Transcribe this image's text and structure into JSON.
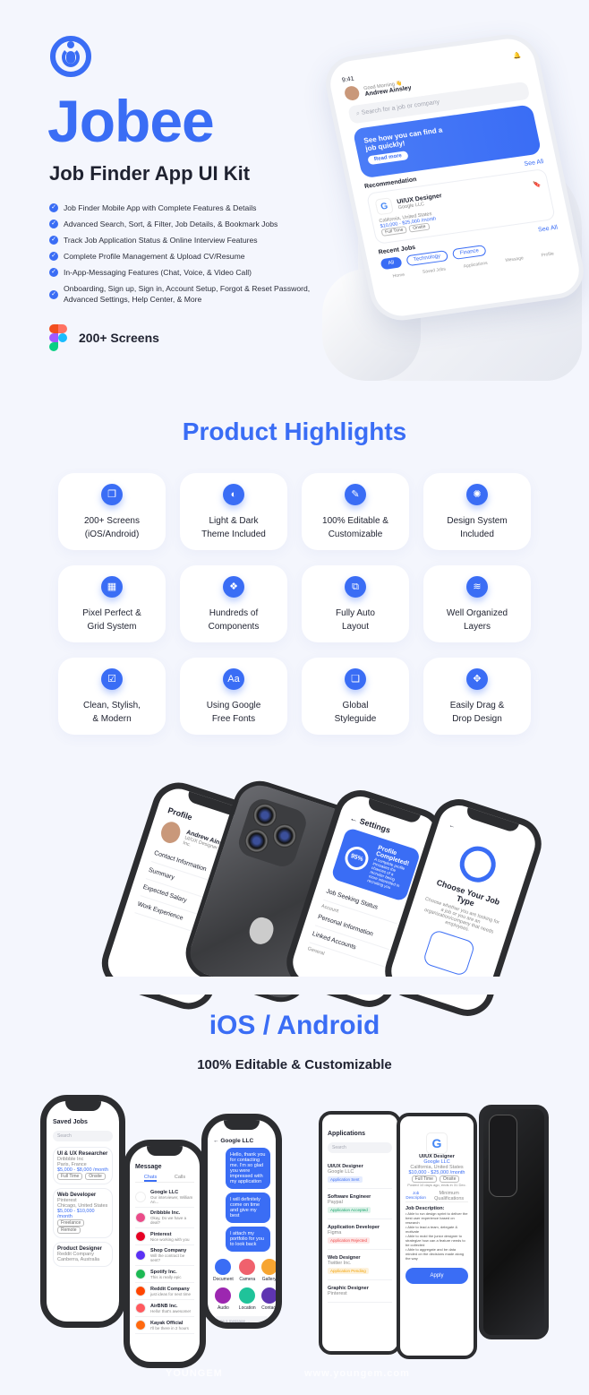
{
  "hero": {
    "logo": "Jobee",
    "title": "Jobee",
    "subtitle": "Job Finder App UI Kit",
    "bullets": [
      "Job Finder Mobile App with Complete Features & Details",
      "Advanced Search, Sort, & Filter, Job Details, & Bookmark Jobs",
      "Track Job Application Status & Online Interview Features",
      "Complete Profile Management & Upload CV/Resume",
      "In-App-Messaging Features (Chat, Voice, & Video Call)",
      "Onboarding, Sign up, Sign in, Account Setup, Forgot & Reset Password, Advanced Settings, Help Center, & More"
    ],
    "screens_label": "200+ Screens",
    "accent": "#3a6df5"
  },
  "hero_phone": {
    "time": "9:41",
    "greeting": "Good Morning 👋",
    "name": "Andrew Ainsley",
    "search_placeholder": "Search for a job or company",
    "banner_text": "See how you can find a job quickly!",
    "banner_button": "Read more",
    "see_all": "See All",
    "recommendation": "Recommendation",
    "job": {
      "logo": "G",
      "title": "UI/UX Designer",
      "company": "Google LLC",
      "location": "California, United States",
      "salary": "$10,000 - $25,000 /month",
      "tags": [
        "Full Time",
        "Onsite"
      ]
    },
    "recent_jobs": "Recent Jobs",
    "chips": [
      "All",
      "Technology",
      "Finance"
    ],
    "nav": [
      "Home",
      "Saved Jobs",
      "Applications",
      "Message",
      "Profile"
    ]
  },
  "highlights": {
    "title": "Product Highlights",
    "cards": [
      {
        "icon": "copy-icon",
        "glyph": "❐",
        "lines": [
          "200+ Screens",
          "(iOS/Android)"
        ]
      },
      {
        "icon": "contrast-icon",
        "glyph": "◐",
        "lines": [
          "Light & Dark",
          "Theme Included"
        ]
      },
      {
        "icon": "edit-icon",
        "glyph": "✎",
        "lines": [
          "100% Editable &",
          "Customizable"
        ]
      },
      {
        "icon": "palette-icon",
        "glyph": "✺",
        "lines": [
          "Design System",
          "Included"
        ]
      },
      {
        "icon": "grid-icon",
        "glyph": "▦",
        "lines": [
          "Pixel Perfect &",
          "Grid System"
        ]
      },
      {
        "icon": "components-icon",
        "glyph": "❖",
        "lines": [
          "Hundreds of",
          "Components"
        ]
      },
      {
        "icon": "auto-layout-icon",
        "glyph": "⧉",
        "lines": [
          "Fully Auto",
          "Layout"
        ]
      },
      {
        "icon": "layers-icon",
        "glyph": "≋",
        "lines": [
          "Well Organized",
          "Layers"
        ]
      },
      {
        "icon": "check-square-icon",
        "glyph": "☑",
        "lines": [
          "Clean, Stylish,",
          "& Modern"
        ]
      },
      {
        "icon": "font-icon",
        "glyph": "Aa",
        "lines": [
          "Using Google",
          "Free Fonts"
        ]
      },
      {
        "icon": "styleguide-icon",
        "glyph": "❏",
        "lines": [
          "Global",
          "Styleguide"
        ]
      },
      {
        "icon": "move-icon",
        "glyph": "✥",
        "lines": [
          "Easily Drag &",
          "Drop Design"
        ]
      }
    ]
  },
  "showcase": {
    "time": "9:41",
    "profile": {
      "title": "Profile",
      "name": "Andrew Ainsley",
      "role": "UI/UX Designer at Paypal Inc.",
      "items": [
        "Contact Information",
        "Summary",
        "Expected Salary",
        "Work Experience"
      ]
    },
    "settings": {
      "title": "Settings",
      "percent": "95%",
      "completed": "Profile Completed!",
      "desc": "A complete profile increases the chances of a recruiter being more interested in recruiting you",
      "status": "Job Seeking Status",
      "section_account": "Account",
      "account_items": [
        "Personal Information",
        "Linked Accounts"
      ],
      "section_general": "General"
    },
    "job_type": {
      "title": "Choose Your Job Type",
      "desc": "Choose whether you are looking for a job or you are an organization/company that needs employees."
    }
  },
  "platform": {
    "title": "iOS / Android",
    "subtitle": "100% Editable & Customizable"
  },
  "saved_jobs": {
    "title": "Saved Jobs",
    "search": "Search",
    "jobs": [
      {
        "title": "UI & UX Researcher",
        "company": "Dribbble Inc",
        "location": "Paris, France",
        "salary": "$5,000 - $8,000 /month",
        "tags": [
          "Full Time",
          "Onsite"
        ]
      },
      {
        "title": "Web Developer",
        "company": "Pinterest",
        "location": "Chicago, United States",
        "salary": "$5,000 - $10,000 /month",
        "tags": [
          "Freelance",
          "Remote"
        ]
      },
      {
        "title": "Product Designer",
        "company": "Reddit Company",
        "location": "Canberra, Australia"
      }
    ]
  },
  "messages": {
    "title": "Message",
    "tabs": [
      "Chats",
      "Calls"
    ],
    "chats": [
      {
        "name": "Google LLC",
        "text": "Our interviewer, William An...",
        "color": "#ffffff"
      },
      {
        "name": "Dribbble Inc.",
        "text": "Okay, Do we have a deal?",
        "color": "#ea4c89"
      },
      {
        "name": "Pinterest",
        "text": "Nice working with you",
        "color": "#e60023"
      },
      {
        "name": "Shop Company",
        "text": "Will the contract be sent?",
        "color": "#5a31f4"
      },
      {
        "name": "Spotify Inc.",
        "text": "This is really epic",
        "color": "#1db954"
      },
      {
        "name": "Reddit Company",
        "text": "just ideas for next time",
        "color": "#ff4500"
      },
      {
        "name": "AirBNB Inc.",
        "text": "Hello! that's awesome!",
        "color": "#ff5a5f"
      },
      {
        "name": "Kayak Official",
        "text": "I'll be there in 2 hours",
        "color": "#ff690f"
      }
    ]
  },
  "chat": {
    "title": "Google LLC",
    "bubbles": [
      "Hello, thank you for contacting me. I'm so glad you were impressed with my application",
      "I will definitely come on time and give my best",
      "I attach my portfolio for you to look back"
    ],
    "attachments": [
      {
        "label": "Document",
        "color": "#3a6df5"
      },
      {
        "label": "Camera",
        "color": "#f0616d"
      },
      {
        "label": "Gallery",
        "color": "#f7a531"
      },
      {
        "label": "Audio",
        "color": "#9c27b0"
      },
      {
        "label": "Location",
        "color": "#1fc39a"
      },
      {
        "label": "Contact",
        "color": "#5e35b1"
      }
    ],
    "input_placeholder": "Type a message ..."
  },
  "applications": {
    "title": "Applications",
    "search": "Search",
    "items": [
      {
        "title": "UI/UX Designer",
        "company": "Google LLC",
        "status": "Application Sent",
        "color": "#3a6df5"
      },
      {
        "title": "Software Engineer",
        "company": "Paypal",
        "status": "Application Accepted",
        "color": "#16a56a"
      },
      {
        "title": "Application Developer",
        "company": "Figma",
        "status": "Application Rejected",
        "color": "#f04b4b"
      },
      {
        "title": "Web Designer",
        "company": "Twitter Inc.",
        "status": "Application Pending",
        "color": "#f2a100"
      },
      {
        "title": "Graphic Designer",
        "company": "Pinterest",
        "status": ""
      }
    ]
  },
  "job_detail": {
    "title": "UI/UX Designer",
    "company": "Google LLC",
    "location": "California, United States",
    "salary": "$10,000 - $25,000 /month",
    "tags": [
      "Full Time",
      "Onsite"
    ],
    "posted": "Posted 10 days ago, ends in 31 Dec.",
    "tabs": [
      "Job Description",
      "Minimum Qualifications"
    ],
    "heading": "Job Description:",
    "points": [
      "Able to run design sprint to deliver the best user experience based on research",
      "Able to lead a team, delegate & motivate",
      "Able to mold the junior designer to strategize how can a feature needs to be collected",
      "Able to aggregate and be data minded on the decisions made along the way"
    ],
    "apply": "Apply"
  },
  "watermark": [
    "YOUNGEM",
    "www.youngem.com"
  ]
}
